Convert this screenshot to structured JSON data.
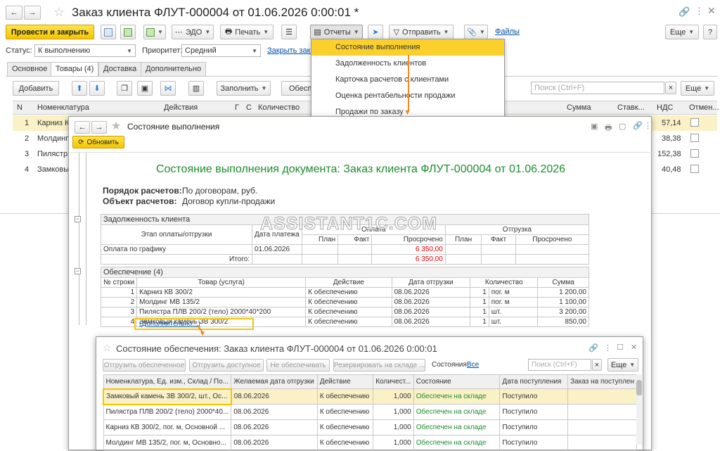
{
  "main": {
    "title": "Заказ клиента ФЛУТ-000004 от 01.06.2026 0:00:01 *",
    "toolbar": {
      "post_close": "Провести и закрыть",
      "edo": "ЭДО",
      "print": "Печать",
      "reports": "Отчеты",
      "send": "Отправить",
      "files": "Файлы",
      "more": "Еще"
    },
    "status_label": "Статус:",
    "status_value": "К выполнению",
    "priority_label": "Приоритет:",
    "priority_value": "Средний",
    "close_link": "Закрыть зака",
    "tabs": [
      "Основное",
      "Товары (4)",
      "Доставка",
      "Дополнительно"
    ],
    "table_toolbar": {
      "add": "Добавить",
      "fill": "Заполнить",
      "provide": "Обесп",
      "search_placeholder": "Поиск (Ctrl+F)",
      "more": "Еще"
    },
    "columns": {
      "n": "N",
      "nomen": "Номенклатура",
      "actions": "Действия",
      "p": "Г",
      "s": "С",
      "qty": "Количество",
      "sum": "Сумма",
      "rate": "Ставк...",
      "vat": "НДС",
      "cancel": "Отмен..."
    },
    "rows": [
      {
        "n": "1",
        "name": "Карниз К",
        "vat": "57,14"
      },
      {
        "n": "2",
        "name": "Молдинг",
        "vat": "38,38"
      },
      {
        "n": "3",
        "name": "Пилястр",
        "vat": "152,38"
      },
      {
        "n": "4",
        "name": "Замковы",
        "vat": "40,48"
      }
    ]
  },
  "reports_menu": [
    "Состояние выполнения",
    "Задолженность клиентов",
    "Карточка расчетов с клиентами",
    "Оценка рентабельности продажи",
    "Продажи по заказу"
  ],
  "report": {
    "title": "Состояние выполнения",
    "refresh": "Обновить",
    "heading": "Состояние выполнения документа: Заказ клиента ФЛУТ-000004 от 01.06.2026",
    "order_label": "Порядок расчетов:",
    "order_value": "По договорам, руб.",
    "object_label": "Объект расчетов:",
    "object_value": "Договор купли-продажи",
    "debt": {
      "title": "Задолженность клиента",
      "stage": "Этап оплаты/отгрузки",
      "date": "Дата платежа",
      "payment": "Оплата",
      "shipment": "Отгрузка",
      "plan": "План",
      "fact": "Факт",
      "overdue": "Просрочено",
      "row_label": "Оплата по графику",
      "row_date": "01.06.2026",
      "row_overdue": "6 350,00",
      "total_label": "Итого:",
      "total_overdue": "6 350,00"
    },
    "supply": {
      "title": "Обеспечение (4)",
      "cols": [
        "№ строки",
        "Товар (услуга)",
        "Действие",
        "Дата отгрузки",
        "Количество",
        "Сумма"
      ],
      "rows": [
        [
          "1",
          "Карниз КВ 300/2",
          "К обеспечению",
          "08.06.2026",
          "1",
          "пог. м",
          "1 200,00"
        ],
        [
          "2",
          "Молдинг МВ 135/2",
          "К обеспечению",
          "08.06.2026",
          "1",
          "пог. м",
          "1 100,00"
        ],
        [
          "3",
          "Пилястра ПЛВ 200/2 (тело) 2000*40*200",
          "К обеспечению",
          "08.06.2026",
          "1",
          "шт.",
          "3 200,00"
        ],
        [
          "4",
          "Замковый камень ЗВ 300/2",
          "К обеспечению",
          "08.06.2026",
          "1",
          "шт.",
          "850,00"
        ]
      ],
      "more_link": "(Дополнительно...)"
    }
  },
  "watermark": "ASSISTANT1C.COM",
  "supply_window": {
    "title": "Состояние обеспечения: Заказ клиента ФЛУТ-000004 от 01.06.2026 0:00:01",
    "buttons": [
      "Отгрузить обеспеченное",
      "Отгрузить доступное",
      "Не обеспечивать",
      "Резервировать на складе ..."
    ],
    "state_label": "Состояния:",
    "state_link": "Все",
    "search_placeholder": "Поиск (Ctrl+F)",
    "more": "Еще",
    "cols": [
      "Номенклатура, Ед. изм., Склад / По...",
      "Желаемая дата отгрузки",
      "Действие",
      "Количест...",
      "Состояние",
      "Дата поступления",
      "Заказ на поступлен"
    ],
    "rows": [
      [
        "Замковый камень ЗВ 300/2, шт., Ос...",
        "08.06.2026",
        "К обеспечению",
        "1,000",
        "Обеспечен на складе",
        "Поступило"
      ],
      [
        "Пилястра ПЛВ 200/2 (тело) 2000*40...",
        "08.06.2026",
        "К обеспечению",
        "1,000",
        "Обеспечен на складе",
        "Поступило"
      ],
      [
        "Карниз КВ 300/2, пог. м, Основной ...",
        "08.06.2026",
        "К обеспечению",
        "1,000",
        "Обеспечен на складе",
        "Поступило"
      ],
      [
        "Молдинг МВ 135/2, пог. м, Основно...",
        "08.06.2026",
        "К обеспечению",
        "1,000",
        "Обеспечен на складе",
        "Поступило"
      ]
    ]
  }
}
